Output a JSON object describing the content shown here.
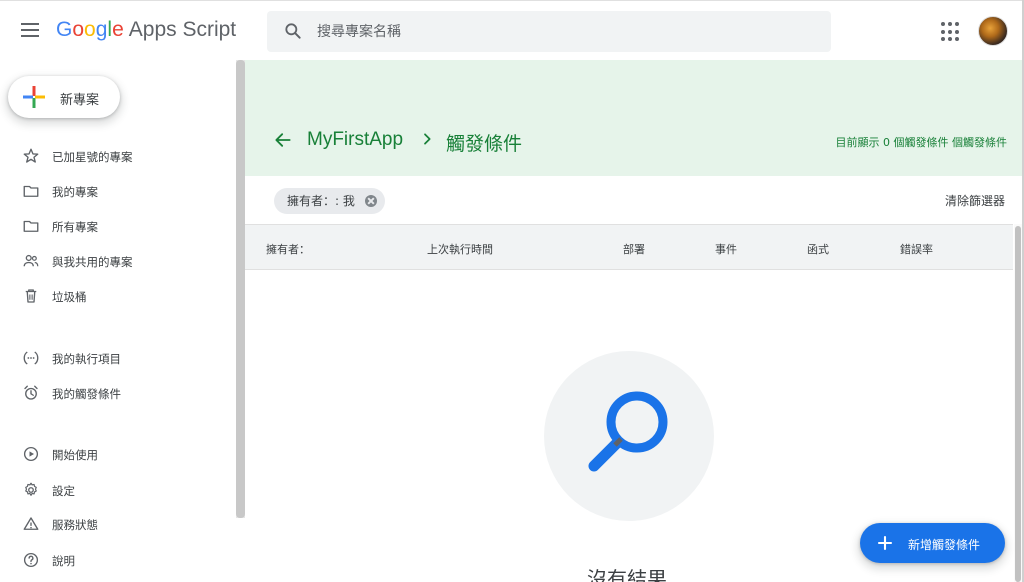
{
  "app": {
    "logo_google": [
      "G",
      "o",
      "o",
      "g",
      "l",
      "e"
    ],
    "logo_product": "Apps Script"
  },
  "search": {
    "placeholder": "搜尋專案名稱",
    "value": ""
  },
  "sidebar": {
    "new_project": "新專案",
    "items": [
      {
        "label": "已加星號的專案",
        "icon": "star-icon"
      },
      {
        "label": "我的專案",
        "icon": "folder-icon"
      },
      {
        "label": "所有專案",
        "icon": "folder-icon"
      },
      {
        "label": "與我共用的專案",
        "icon": "people-icon"
      },
      {
        "label": "垃圾桶",
        "icon": "trash-icon"
      },
      {
        "label": "我的執行項目",
        "icon": "executions-icon"
      },
      {
        "label": "我的觸發條件",
        "icon": "alarm-icon"
      },
      {
        "label": "開始使用",
        "icon": "play-circle-icon"
      },
      {
        "label": "設定",
        "icon": "gear-icon"
      },
      {
        "label": "服務狀態",
        "icon": "warning-icon"
      },
      {
        "label": "說明",
        "icon": "help-icon"
      }
    ]
  },
  "header": {
    "project_name": "MyFirstApp",
    "page_title": "觸發條件",
    "count_text": "目前顯示 0 個觸發條件 個觸發條件"
  },
  "filter": {
    "chip_label": "擁有者：: 我",
    "clear_label": "清除篩選器"
  },
  "table": {
    "columns": [
      "擁有者：",
      "上次執行時間",
      "部署",
      "事件",
      "函式",
      "錯誤率"
    ]
  },
  "empty_state": {
    "text": "沒有結果"
  },
  "fab": {
    "label": "新增觸發條件"
  },
  "colors": {
    "accent": "#188038",
    "header_bg": "#e6f4ea",
    "fab": "#1a73e8"
  }
}
